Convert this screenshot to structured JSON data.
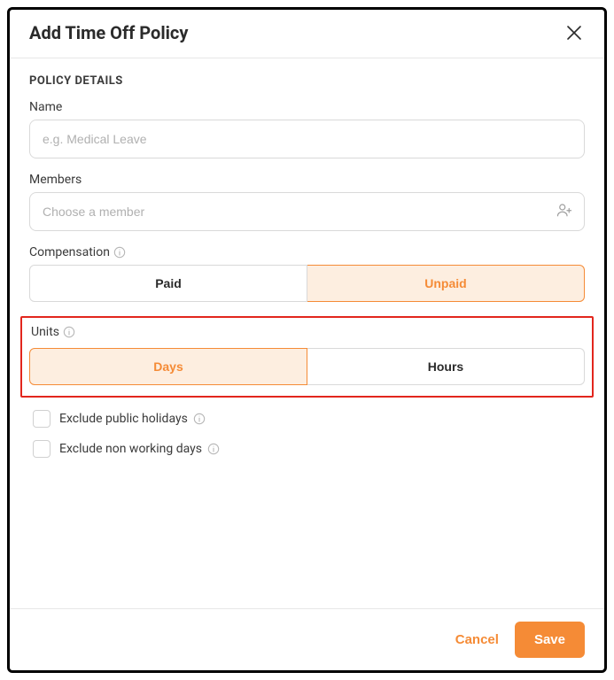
{
  "modal": {
    "title": "Add Time Off Policy"
  },
  "section": {
    "heading": "POLICY DETAILS"
  },
  "fields": {
    "name": {
      "label": "Name",
      "placeholder": "e.g. Medical Leave",
      "value": ""
    },
    "members": {
      "label": "Members",
      "placeholder": "Choose a member",
      "value": ""
    },
    "compensation": {
      "label": "Compensation",
      "options": {
        "paid": "Paid",
        "unpaid": "Unpaid"
      },
      "selected": "unpaid"
    },
    "units": {
      "label": "Units",
      "options": {
        "days": "Days",
        "hours": "Hours"
      },
      "selected": "days"
    },
    "exclude_holidays": {
      "label": "Exclude public holidays",
      "checked": false
    },
    "exclude_nonworking": {
      "label": "Exclude non working days",
      "checked": false
    }
  },
  "footer": {
    "cancel": "Cancel",
    "save": "Save"
  }
}
